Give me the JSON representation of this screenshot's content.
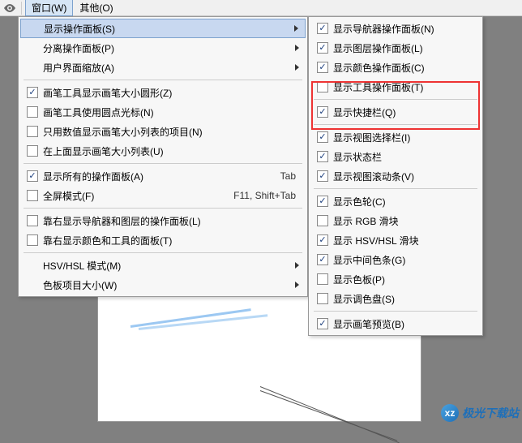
{
  "menubar": {
    "window": "窗口(W)",
    "other": "其他(O)"
  },
  "left_menu": {
    "show_panel": "显示操作面板(S)",
    "detach_panel": "分离操作面板(P)",
    "ui_zoom": "用户界面缩放(A)",
    "brush_circle": "画笔工具显示画笔大小圆形(Z)",
    "brush_dot": "画笔工具使用圆点光标(N)",
    "only_num": "只用数值显示画笔大小列表的项目(N)",
    "above_list": "在上面显示画笔大小列表(U)",
    "show_all_panels": "显示所有的操作面板(A)",
    "fullscreen": "全屏模式(F)",
    "right_nav_layer": "靠右显示导航器和图层的操作面板(L)",
    "right_color_tool": "靠右显示颜色和工具的面板(T)",
    "hsv_mode": "HSV/HSL 模式(M)",
    "palette_size": "色板项目大小(W)",
    "accel_tab": "Tab",
    "accel_f11": "F11, Shift+Tab"
  },
  "right_menu": {
    "nav_panel": "显示导航器操作面板(N)",
    "layer_panel": "显示图层操作面板(L)",
    "color_panel": "显示颜色操作面板(C)",
    "tool_panel": "显示工具操作面板(T)",
    "quickbar": "显示快捷栏(Q)",
    "view_selector": "显示视图选择栏(I)",
    "statusbar": "显示状态栏",
    "scrollbar": "显示视图滚动条(V)",
    "color_wheel": "显示色轮(C)",
    "rgb_slider": "显示 RGB 滑块",
    "hsv_slider": "显示 HSV/HSL 滑块",
    "mid_strip": "显示中间色条(G)",
    "palette": "显示色板(P)",
    "color_disk": "显示调色盘(S)",
    "brush_preview": "显示画笔预览(B)"
  },
  "watermark": "极光下载站"
}
